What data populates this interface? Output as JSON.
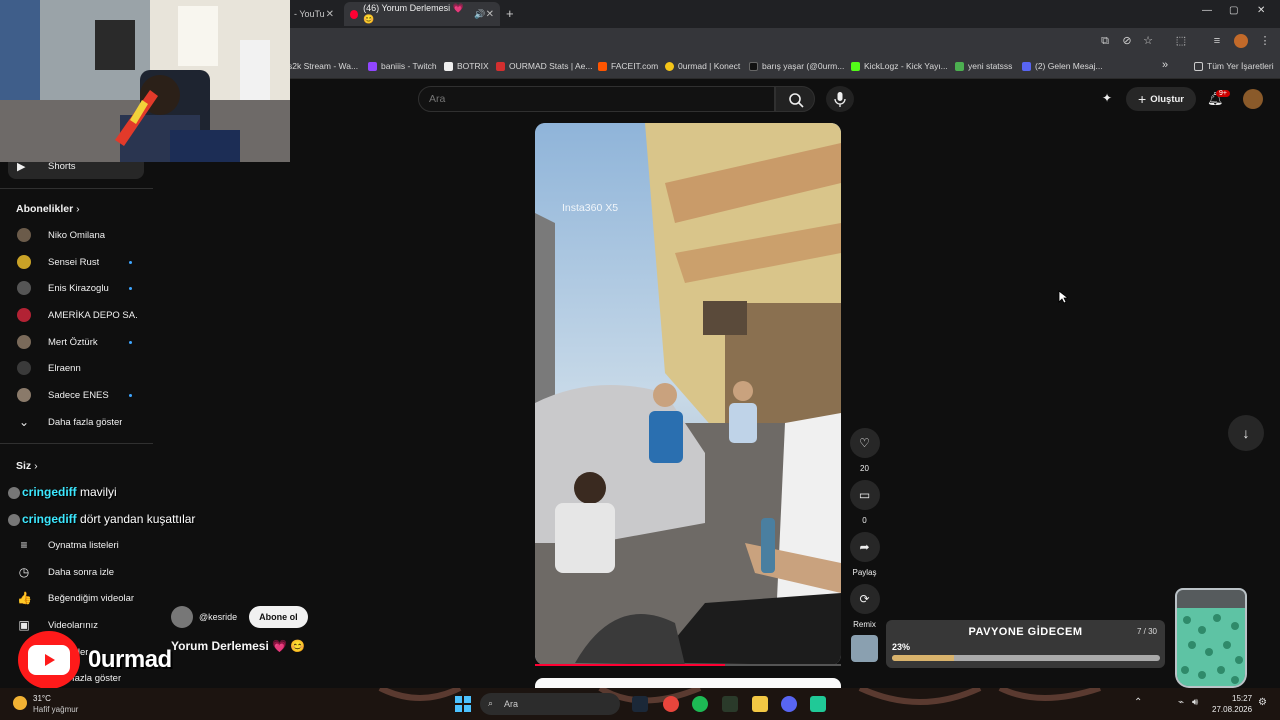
{
  "browser": {
    "tabs": [
      {
        "label": "- YouTu",
        "active": false
      },
      {
        "label": "(46) Yorum Derlemesi 💗 😊",
        "active": true
      }
    ],
    "new_tab": "+",
    "window_controls": [
      "—",
      "▢",
      "✕"
    ]
  },
  "bookmarks": [
    {
      "label": "s2k Stream - Wa...",
      "color": "#888888"
    },
    {
      "label": "baniiis - Twitch",
      "color": "#9146ff"
    },
    {
      "label": "BOTRIX",
      "color": "#ffffff"
    },
    {
      "label": "OURMAD Stats | Ae...",
      "color": "#d32f2f"
    },
    {
      "label": "FACEIT.com",
      "color": "#ff5500"
    },
    {
      "label": "0urmad | Konect",
      "color": "#f5c518"
    },
    {
      "label": "barış yaşar (@0urm...",
      "color": "#000000"
    },
    {
      "label": "KickLogz - Kick Yayı...",
      "color": "#53fc18"
    },
    {
      "label": "yeni statsss",
      "color": "#4caf50"
    },
    {
      "label": "(2) Gelen Mesaj...",
      "color": "#5865f2"
    }
  ],
  "bookmarks_more": "»",
  "bookmarks_all": "Tüm Yer İşaretleri",
  "youtube": {
    "search_placeholder": "Ara",
    "create_label": "Oluştur",
    "notif_badge": "9+",
    "sidebar": {
      "shorts": "Shorts",
      "subscriptions_header": "Abonelikler",
      "subscriptions": [
        {
          "label": "Niko Omilana",
          "dot": false,
          "color": "#6b5b4a"
        },
        {
          "label": "Sensei Rust",
          "dot": true,
          "color": "#c9a227"
        },
        {
          "label": "Enis Kirazoglu",
          "dot": true,
          "color": "#555555"
        },
        {
          "label": "AMERİKA DEPO SA...",
          "dot": false,
          "color": "#b22234"
        },
        {
          "label": "Mert Öztürk",
          "dot": true,
          "color": "#7a6a5a"
        },
        {
          "label": "Elraenn",
          "dot": false,
          "color": "#3a3a3a"
        },
        {
          "label": "Sadece ENES",
          "dot": true,
          "color": "#8a7a6a"
        }
      ],
      "show_more": "Daha fazla göster",
      "you_header": "Siz",
      "you_items": [
        {
          "label": "Oynatma listeleri",
          "icon": "playlist-icon"
        },
        {
          "label": "Daha sonra izle",
          "icon": "clock-icon"
        },
        {
          "label": "Beğendiğim videolar",
          "icon": "thumbs-up-icon"
        },
        {
          "label": "Videolarınız",
          "icon": "video-icon"
        }
      ],
      "partial_item": "mler",
      "bottom_more": "fazla göster"
    },
    "video": {
      "watermark": "Insta360 X5",
      "likes": "20",
      "comments": "0",
      "share_label": "Paylaş",
      "remix_label": "Remix",
      "channel": "@kesride",
      "subscribe_label": "Abone ol",
      "title": "Yorum Derlemesi 💗 😊"
    }
  },
  "overlay": {
    "chat": [
      {
        "user": "cringediff",
        "message": "mavilyi"
      },
      {
        "user": "cringediff",
        "message": "dört yandan kuşattılar"
      }
    ],
    "brand": "0urmad",
    "goal": {
      "title": "PAVYONE GİDECEM",
      "count": "7 / 30",
      "percent_label": "23%",
      "progress": 0.23
    }
  },
  "taskbar": {
    "temperature": "31°C",
    "weather": "Hafif yağmur",
    "search": "Ara",
    "time": "15:27",
    "date": "27.08.2026"
  }
}
